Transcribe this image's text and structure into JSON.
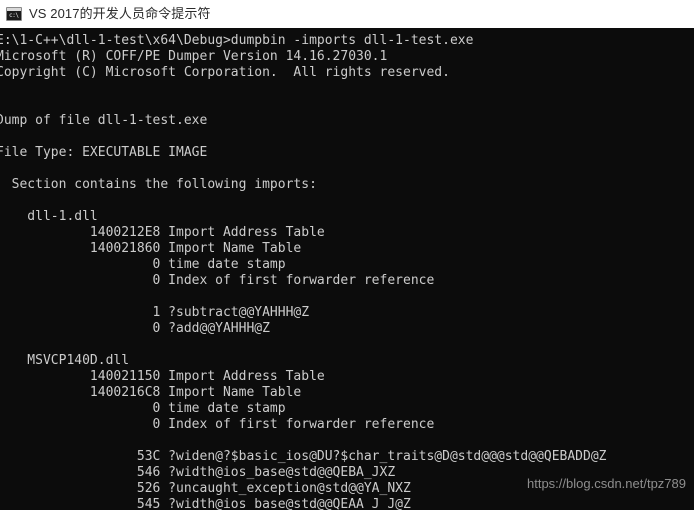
{
  "window": {
    "title": "VS 2017的开发人员命令提示符",
    "icon_name": "console-window-icon",
    "icon_glyph": "c:\\",
    "background_color": "#0c0c0c",
    "titlebar_background_color": "#ffffff",
    "text_color": "#cccccc"
  },
  "console": {
    "prompt_line": "E:\\1-C++\\dll-1-test\\x64\\Debug>dumpbin -imports dll-1-test.exe",
    "lines": [
      "E:\\1-C++\\dll-1-test\\x64\\Debug>dumpbin -imports dll-1-test.exe",
      "Microsoft (R) COFF/PE Dumper Version 14.16.27030.1",
      "Copyright (C) Microsoft Corporation.  All rights reserved.",
      "",
      "",
      "Dump of file dll-1-test.exe",
      "",
      "File Type: EXECUTABLE IMAGE",
      "",
      "  Section contains the following imports:",
      "",
      "    dll-1.dll",
      "            1400212E8 Import Address Table",
      "            140021860 Import Name Table",
      "                    0 time date stamp",
      "                    0 Index of first forwarder reference",
      "",
      "                    1 ?subtract@@YAHHH@Z",
      "                    0 ?add@@YAHHH@Z",
      "",
      "    MSVCP140D.dll",
      "            140021150 Import Address Table",
      "            1400216C8 Import Name Table",
      "                    0 time date stamp",
      "                    0 Index of first forwarder reference",
      "",
      "                  53C ?widen@?$basic_ios@DU?$char_traits@D@std@@@std@@QEBADD@Z",
      "                  546 ?width@ios_base@std@@QEBA_JXZ",
      "                  526 ?uncaught_exception@std@@YA_NXZ",
      "                  545 ?width@ios_base@std@@QEAA_J_J@Z"
    ],
    "command": "dumpbin -imports dll-1-test.exe",
    "working_directory": "E:\\1-C++\\dll-1-test\\x64\\Debug",
    "tool_banner": "Microsoft (R) COFF/PE Dumper Version 14.16.27030.1",
    "copyright": "Copyright (C) Microsoft Corporation.  All rights reserved.",
    "dump_target": "Dump of file dll-1-test.exe",
    "file_type": "File Type: EXECUTABLE IMAGE",
    "section_header": "Section contains the following imports:",
    "imports": [
      {
        "dll": "dll-1.dll",
        "import_address_table": "1400212E8",
        "import_name_table": "140021860",
        "time_date_stamp": "0",
        "first_forwarder_index": "0",
        "symbols": [
          {
            "ordinal": "1",
            "name": "?subtract@@YAHHH@Z"
          },
          {
            "ordinal": "0",
            "name": "?add@@YAHHH@Z"
          }
        ]
      },
      {
        "dll": "MSVCP140D.dll",
        "import_address_table": "140021150",
        "import_name_table": "1400216C8",
        "time_date_stamp": "0",
        "first_forwarder_index": "0",
        "symbols": [
          {
            "ordinal": "53C",
            "name": "?widen@?$basic_ios@DU?$char_traits@D@std@@@std@@QEBADD@Z"
          },
          {
            "ordinal": "546",
            "name": "?width@ios_base@std@@QEBA_JXZ"
          },
          {
            "ordinal": "526",
            "name": "?uncaught_exception@std@@YA_NXZ"
          },
          {
            "ordinal": "545",
            "name": "?width@ios_base@std@@QEAA_J_J@Z"
          }
        ]
      }
    ]
  },
  "watermark": {
    "text": "https://blog.csdn.net/tpz789"
  }
}
